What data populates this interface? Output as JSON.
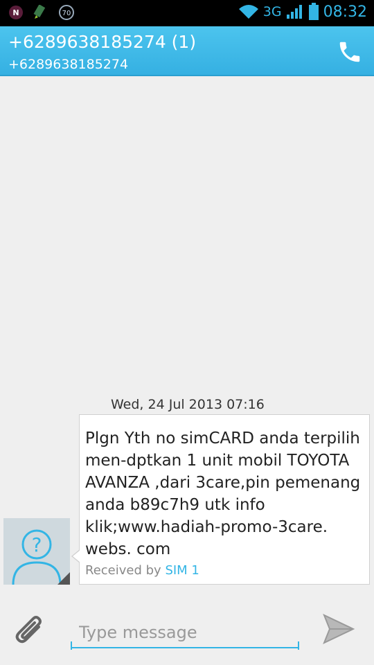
{
  "statusbar": {
    "icons_left": [
      "n-app-icon",
      "pen-icon",
      "speed-70-icon"
    ],
    "speed_badge": "70",
    "network": "3G",
    "time": "08:32"
  },
  "header": {
    "title": "+6289638185274 (1)",
    "subtitle": "+6289638185274"
  },
  "conversation": {
    "timestamp": "Wed, 24 Jul 2013 07:16",
    "message": {
      "text": "Plgn Yth no simCARD anda terpilih men-dptkan 1 unit mobil TOYOTA AVANZA ,dari 3care,pin pemenang anda b89c7h9 utk info klik;www.hadiah-promo-3care. webs. com",
      "received_prefix": "Received by",
      "sim": "SIM 1"
    }
  },
  "composer": {
    "placeholder": "Type message"
  },
  "colors": {
    "accent": "#33b5e5",
    "header": "#3fb9e8",
    "background": "#efefef"
  }
}
